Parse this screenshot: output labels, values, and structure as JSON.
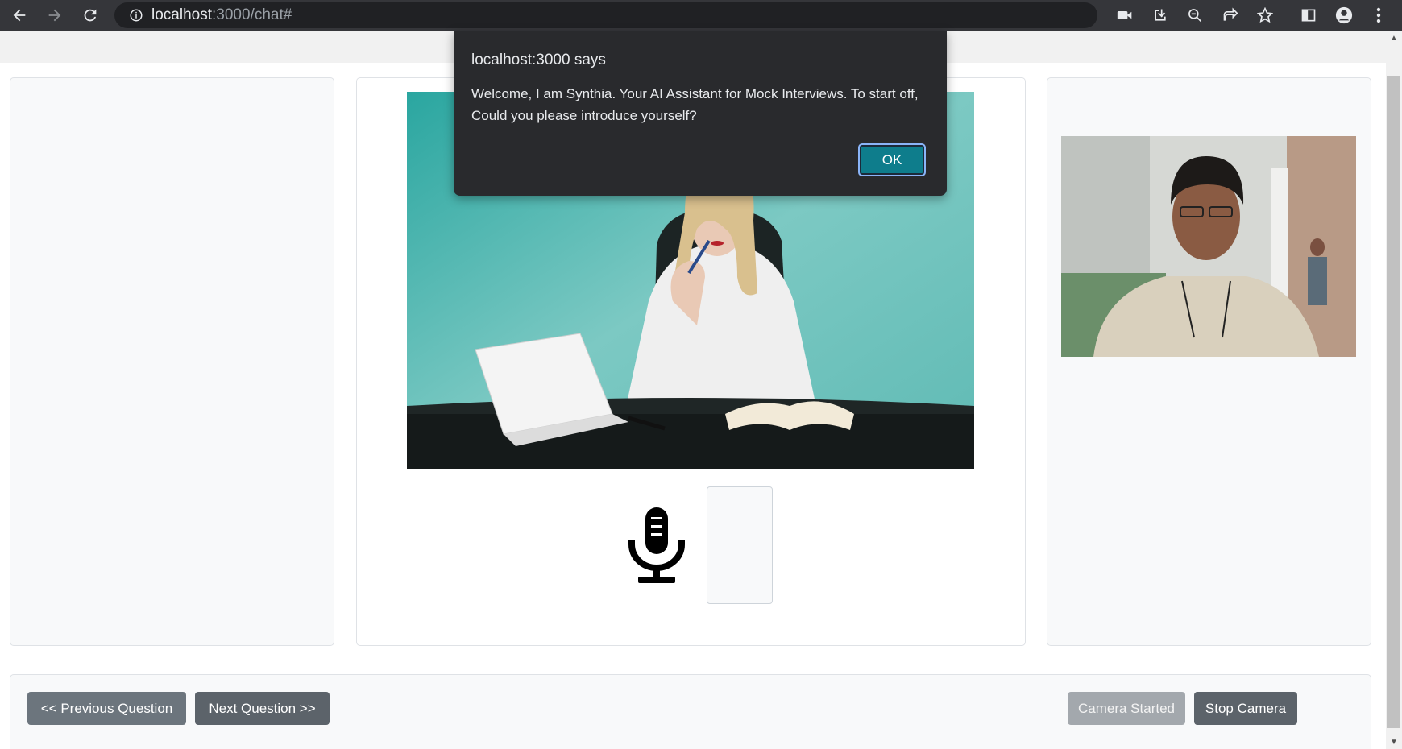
{
  "browser": {
    "url_host": "localhost",
    "url_rest": ":3000/chat#"
  },
  "dialog": {
    "title": "localhost:3000 says",
    "message": "Welcome, I am Synthia. Your AI Assistant for Mock Interviews. To start off, Could you please introduce yourself?",
    "ok_label": "OK"
  },
  "footer": {
    "prev_label": "<< Previous Question",
    "next_label": "Next Question >>",
    "camera_status_label": "Camera Started",
    "stop_camera_label": "Stop Camera"
  },
  "colors": {
    "chrome": "#35363a",
    "dialog_bg": "#292a2d",
    "ok_button": "#0e7d8c",
    "secondary_button": "#6c757d"
  }
}
